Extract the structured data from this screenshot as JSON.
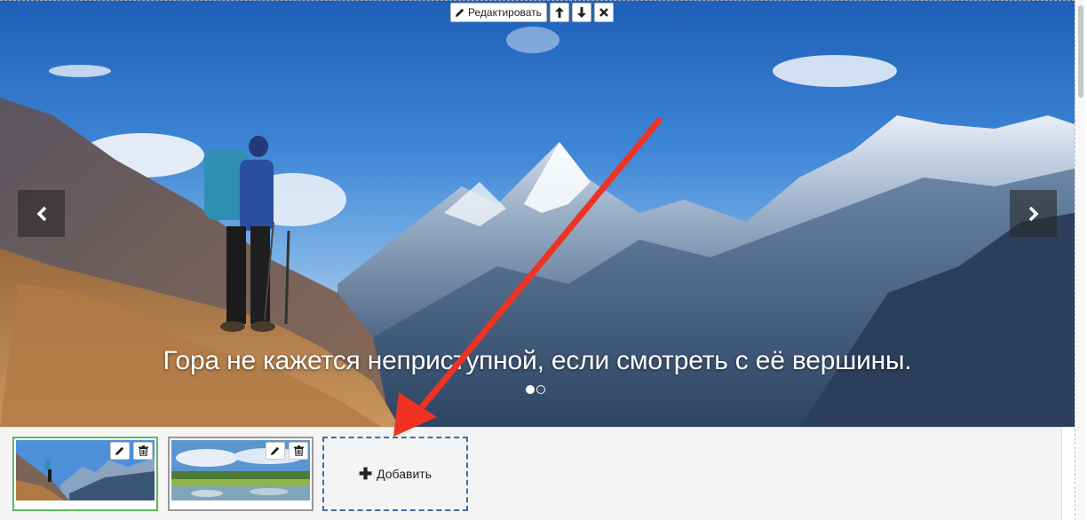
{
  "toolbar": {
    "edit_label": "Редактировать"
  },
  "slider": {
    "caption": "Гора не кажется неприступной, если смотреть с её вершины.",
    "active_slide": 1,
    "slide_count": 2
  },
  "thumbnails": {
    "add_label": "Добавить"
  },
  "colors": {
    "selected_border": "#5cb85c",
    "add_border": "#3f6fa3",
    "annotation_arrow": "#ee3322"
  },
  "icons": [
    "pencil-icon",
    "arrow-up-icon",
    "arrow-down-icon",
    "close-icon",
    "chevron-left-icon",
    "chevron-right-icon",
    "trash-icon",
    "plus-icon"
  ]
}
